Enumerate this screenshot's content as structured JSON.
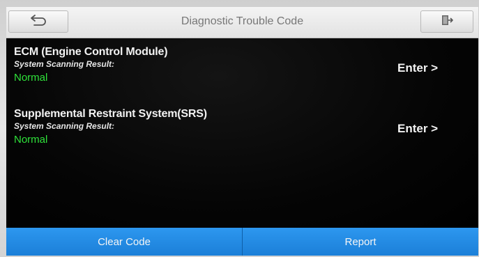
{
  "header": {
    "title": "Diagnostic Trouble Code",
    "back_icon": "back-arrow-icon",
    "exit_icon": "exit-door-icon"
  },
  "modules": [
    {
      "name": "ECM (Engine Control Module)",
      "subtitle": "System Scanning Result:",
      "status": "Normal",
      "enter_label": "Enter >"
    },
    {
      "name": "Supplemental Restraint System(SRS)",
      "subtitle": "System Scanning Result:",
      "status": "Normal",
      "enter_label": "Enter >"
    }
  ],
  "footer": {
    "clear_label": "Clear Code",
    "report_label": "Report"
  },
  "colors": {
    "status_normal": "#2fe23a",
    "footer_blue": "#1f88e0",
    "background": "#000000"
  }
}
